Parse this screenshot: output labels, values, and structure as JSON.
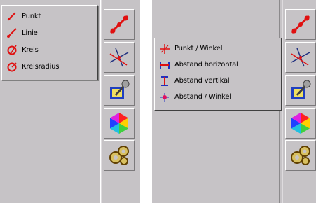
{
  "left_panel": {
    "menu": {
      "items": [
        {
          "label": "Punkt",
          "icon": "point-pencil-icon"
        },
        {
          "label": "Linie",
          "icon": "line-pencil-icon"
        },
        {
          "label": "Kreis",
          "icon": "circle-pencil-icon"
        },
        {
          "label": "Kreisradius",
          "icon": "circle-radius-pencil-icon"
        }
      ]
    }
  },
  "right_panel": {
    "menu": {
      "items": [
        {
          "label": "Punkt / Winkel",
          "icon": "point-angle-icon"
        },
        {
          "label": "Abstand horizontal",
          "icon": "horizontal-distance-icon"
        },
        {
          "label": "Abstand vertikal",
          "icon": "vertical-distance-icon"
        },
        {
          "label": "Abstand / Winkel",
          "icon": "distance-angle-icon"
        }
      ]
    }
  },
  "toolbar": {
    "buttons": [
      {
        "name": "draw-tool",
        "icon": "red-line-points-icon"
      },
      {
        "name": "construct-tool",
        "icon": "intersecting-lines-icon"
      },
      {
        "name": "edit-tool",
        "icon": "pencil-pad-icon"
      },
      {
        "name": "color-tool",
        "icon": "color-hexagon-icon"
      },
      {
        "name": "settings-tool",
        "icon": "gears-icon"
      }
    ]
  },
  "colors": {
    "panel": "#c6c3c6",
    "red": "#e01010",
    "blue": "#2030c0"
  }
}
